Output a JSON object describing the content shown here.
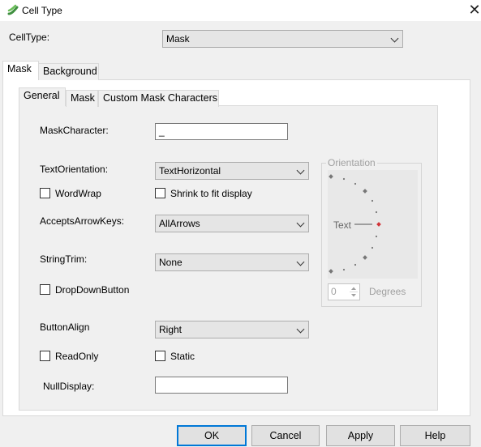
{
  "window": {
    "title": "Cell Type",
    "close_glyph": "✕"
  },
  "celltype": {
    "label": "CellType:",
    "value": "Mask"
  },
  "outer_tabs": [
    "Mask",
    "Background"
  ],
  "inner_tabs": [
    "General",
    "Mask",
    "Custom Mask Characters"
  ],
  "general": {
    "mask_character_label": "MaskCharacter:",
    "mask_character_value": "_",
    "text_orientation_label": "TextOrientation:",
    "text_orientation_value": "TextHorizontal",
    "wordwrap_label": "WordWrap",
    "shrink_label": "Shrink to fit display",
    "accepts_arrow_keys_label": "AcceptsArrowKeys:",
    "accepts_arrow_keys_value": "AllArrows",
    "string_trim_label": "StringTrim:",
    "string_trim_value": "None",
    "dropdown_button_label": "DropDownButton",
    "button_align_label": "ButtonAlign",
    "button_align_value": "Right",
    "readonly_label": "ReadOnly",
    "static_label": "Static",
    "null_display_label": "NullDisplay:",
    "null_display_value": ""
  },
  "orientation": {
    "legend": "Orientation",
    "text_label": "Text",
    "degrees_value": "0",
    "degrees_label": "Degrees"
  },
  "buttons": {
    "ok": "OK",
    "cancel": "Cancel",
    "apply": "Apply",
    "help": "Help"
  },
  "colors": {
    "accent": "#0078d7",
    "indicator_selected": "#d13438"
  }
}
